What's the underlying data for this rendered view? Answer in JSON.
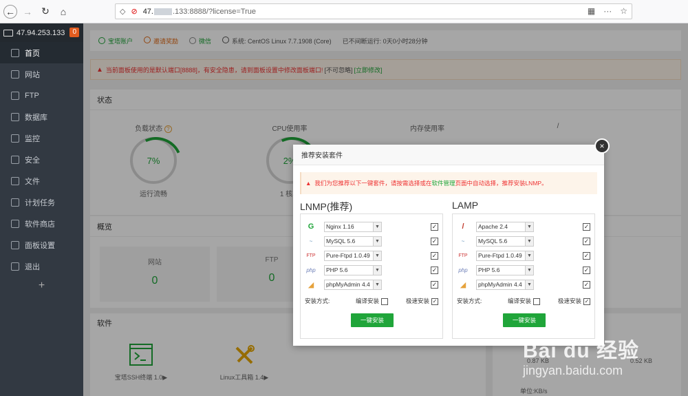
{
  "browser": {
    "url_host": "47.",
    "url_mid": ".133:8888/?license=True"
  },
  "sidebar": {
    "server_ip": "47.94.253.133",
    "badge": "0",
    "items": [
      {
        "label": "首页"
      },
      {
        "label": "网站"
      },
      {
        "label": "FTP"
      },
      {
        "label": "数据库"
      },
      {
        "label": "监控"
      },
      {
        "label": "安全"
      },
      {
        "label": "文件"
      },
      {
        "label": "计划任务"
      },
      {
        "label": "软件商店"
      },
      {
        "label": "面板设置"
      },
      {
        "label": "退出"
      }
    ],
    "plus": "+"
  },
  "topinfo": {
    "account": "宝塔账户",
    "invite": "邀请奖励",
    "wechat": "微信",
    "system": "系统: CentOS Linux 7.7.1908 (Core)",
    "uptime": "已不间断运行: 0天0小时28分钟"
  },
  "warning": {
    "text": "当前面板使用的是默认端口[8888]，有安全隐患，请到面板设置中修改面板端口!",
    "ignore": "[不可忽略]",
    "fix": "[立即修改]"
  },
  "status": {
    "title": "状态",
    "gauges": [
      {
        "label": "负载状态",
        "value": "7%",
        "sub": "运行流畅",
        "help": "?"
      },
      {
        "label": "CPU使用率",
        "value": "2%",
        "sub": "1 核心"
      },
      {
        "label": "内存使用率",
        "value": "",
        "sub": ""
      },
      {
        "label": "/",
        "value": "",
        "sub": ""
      }
    ]
  },
  "overview": {
    "title": "概览",
    "boxes": [
      {
        "label": "网站",
        "value": "0"
      },
      {
        "label": "FTP",
        "value": "0"
      }
    ]
  },
  "software": {
    "title": "软件",
    "items": [
      {
        "label": "宝塔SSH终端 1.0▶"
      },
      {
        "label": "Linux工具箱 1.4▶"
      }
    ]
  },
  "traffic": {
    "up": "0.87 KB",
    "down": "0.52 KB",
    "unit": "单位:KB/s"
  },
  "modal": {
    "title": "推荐安装套件",
    "close": "×",
    "warn_prefix": "我们为您推荐以下一键套件，请按需选择或在",
    "warn_link": "软件管理",
    "warn_suffix": "页面中自动选择，推荐安装LNMP。",
    "lnmp": {
      "title": "LNMP(推荐)",
      "rows": [
        {
          "logo": "G",
          "value": "Nginx 1.16",
          "checked": "✓"
        },
        {
          "logo": "~",
          "value": "MySQL 5.6",
          "checked": "✓"
        },
        {
          "logo": "FTP",
          "value": "Pure-Ftpd 1.0.49",
          "checked": "✓"
        },
        {
          "logo": "php",
          "value": "PHP 5.6",
          "checked": "✓"
        },
        {
          "logo": "◢",
          "value": "phpMyAdmin 4.4",
          "checked": "✓"
        }
      ],
      "method_label": "安装方式:",
      "compile": "编译安装",
      "compile_checked": "",
      "fast": "极速安装",
      "fast_checked": "✓",
      "button": "一键安装"
    },
    "lamp": {
      "title": "LAMP",
      "rows": [
        {
          "logo": "/",
          "value": "Apache 2.4",
          "checked": "✓"
        },
        {
          "logo": "~",
          "value": "MySQL 5.6",
          "checked": "✓"
        },
        {
          "logo": "FTP",
          "value": "Pure-Ftpd 1.0.49",
          "checked": "✓"
        },
        {
          "logo": "php",
          "value": "PHP 5.6",
          "checked": "✓"
        },
        {
          "logo": "◢",
          "value": "phpMyAdmin 4.4",
          "checked": "✓"
        }
      ],
      "method_label": "安装方式:",
      "compile": "编译安装",
      "compile_checked": "",
      "fast": "极速安装",
      "fast_checked": "✓",
      "button": "一键安装"
    }
  },
  "watermark": {
    "logo": "Bai du 经验",
    "url": "jingyan.baidu.com"
  }
}
